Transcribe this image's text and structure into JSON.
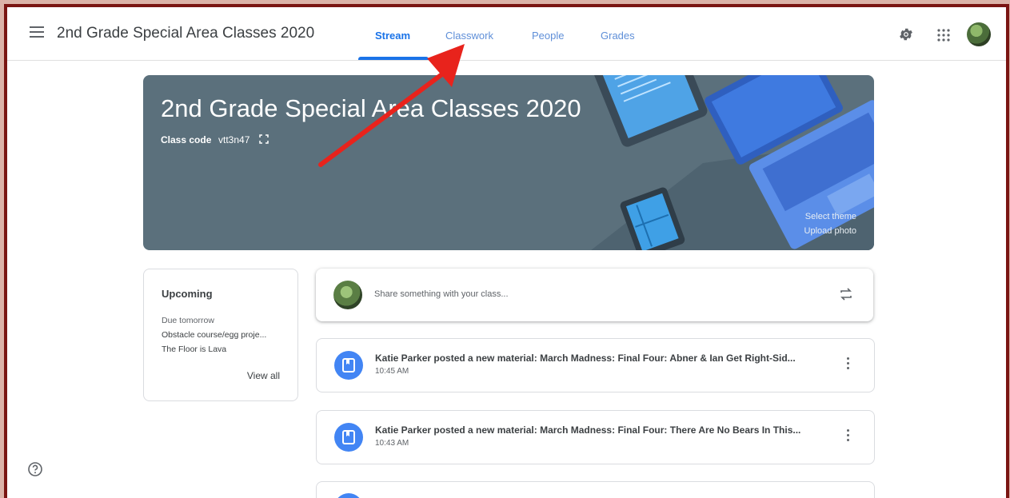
{
  "header": {
    "class_title": "2nd Grade Special Area Classes 2020",
    "tabs": [
      {
        "label": "Stream",
        "active": true
      },
      {
        "label": "Classwork",
        "active": false
      },
      {
        "label": "People",
        "active": false
      },
      {
        "label": "Grades",
        "active": false
      }
    ],
    "icons": [
      "menu-icon",
      "settings-gear-icon",
      "google-apps-icon",
      "account-avatar"
    ]
  },
  "banner": {
    "title": "2nd Grade Special Area Classes 2020",
    "class_code_label": "Class code",
    "class_code_value": "vtt3n47",
    "select_theme": "Select theme",
    "upload_photo": "Upload photo"
  },
  "upcoming": {
    "title": "Upcoming",
    "due_label": "Due tomorrow",
    "items": [
      "Obstacle course/egg proje...",
      "The Floor is Lava"
    ],
    "view_all": "View all"
  },
  "share": {
    "placeholder": "Share something with your class..."
  },
  "posts": [
    {
      "text": "Katie Parker posted a new material: March Madness: Final Four: Abner & Ian Get Right-Sid...",
      "time": "10:45 AM"
    },
    {
      "text": "Katie Parker posted a new material: March Madness: Final Four: There Are No Bears In This...",
      "time": "10:43 AM"
    }
  ],
  "colors": {
    "accent": "#1a73e8",
    "banner": "#5b707c",
    "annotation_arrow": "#e8231c",
    "frame": "#7a1512"
  }
}
